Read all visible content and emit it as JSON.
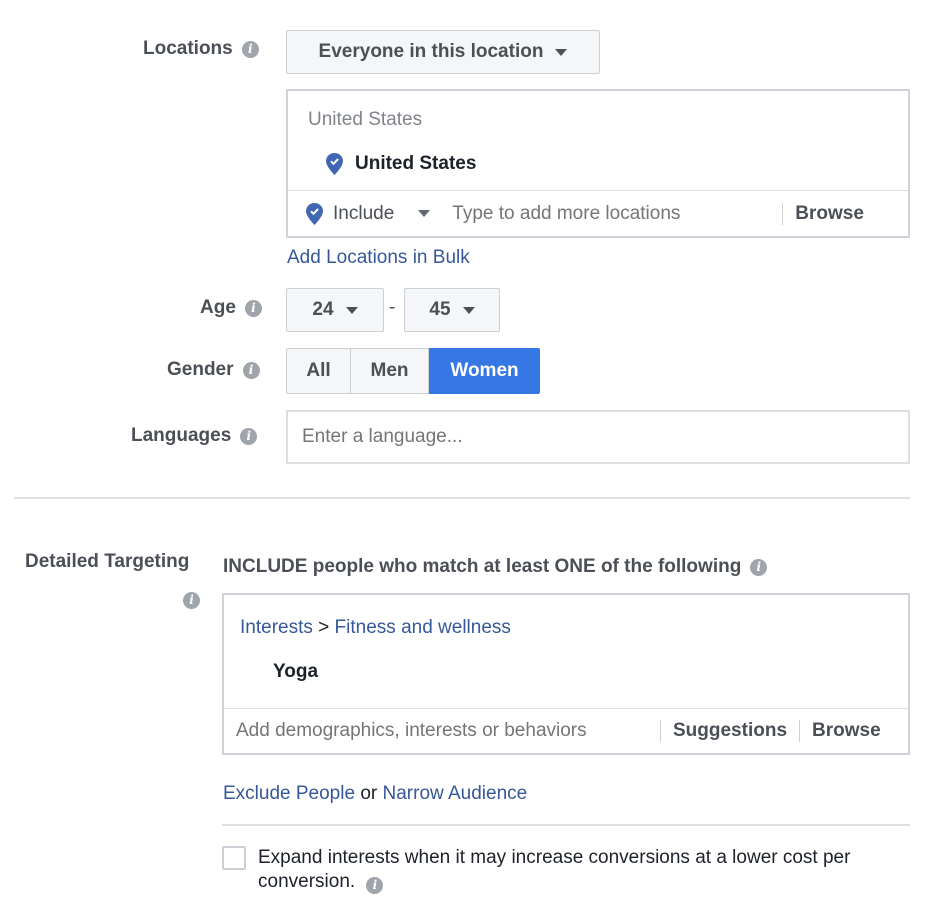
{
  "locations": {
    "label": "Locations",
    "mode_dropdown": "Everyone in this location",
    "list_header": "United States",
    "selected": [
      "United States"
    ],
    "include_label": "Include",
    "input_placeholder": "Type to add more locations",
    "browse_label": "Browse",
    "bulk_link": "Add Locations in Bulk"
  },
  "age": {
    "label": "Age",
    "min": "24",
    "separator": "-",
    "max": "45"
  },
  "gender": {
    "label": "Gender",
    "options": [
      "All",
      "Men",
      "Women"
    ],
    "selected": "Women"
  },
  "languages": {
    "label": "Languages",
    "placeholder": "Enter a language..."
  },
  "detailed_targeting": {
    "label": "Detailed Targeting",
    "include_heading": "INCLUDE people who match at least ONE of the following",
    "breadcrumb": {
      "category": "Interests",
      "arrow": ">",
      "subcategory": "Fitness and wellness"
    },
    "items": [
      "Yoga"
    ],
    "input_placeholder": "Add demographics, interests or behaviors",
    "suggestions_label": "Suggestions",
    "browse_label": "Browse",
    "exclude_link": "Exclude People",
    "or_text": "or",
    "narrow_link": "Narrow Audience",
    "expand_checkbox_label": "Expand interests when it may increase conversions at a lower cost per conversion.",
    "expand_checked": false
  },
  "colors": {
    "accent": "#3578e5",
    "link": "#365899",
    "label": "#4b4f56",
    "pin": "#4267b2"
  }
}
